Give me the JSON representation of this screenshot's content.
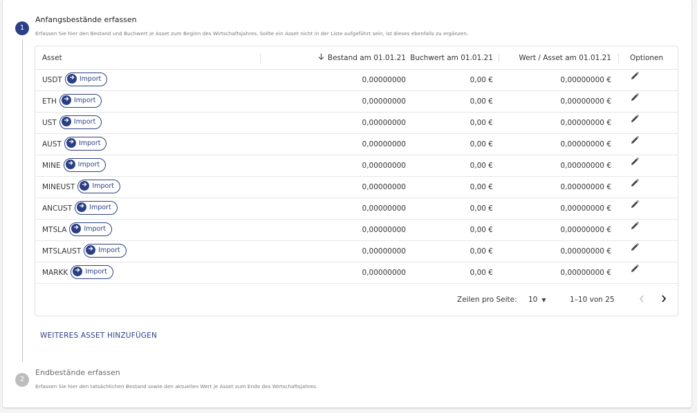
{
  "steps": [
    {
      "number": "1",
      "title": "Anfangsbestände erfassen",
      "description": "Erfassen Sie hier den Bestand und Buchwert je Asset zum Beginn des Wirtschaftsjahres. Sollte ein Asset nicht in der Liste aufgeführt sein, ist dieses ebenfalls zu ergänzen."
    },
    {
      "number": "2",
      "title": "Endbestände erfassen",
      "description": "Erfassen Sie hier den tatsächlichen Bestand sowie den aktuellen Wert je Asset zum Ende des Wirtschaftsjahres."
    }
  ],
  "table": {
    "columns": {
      "asset": "Asset",
      "bestand": "Bestand am 01.01.21",
      "buchwert": "Buchwert am 01.01.21",
      "wert": "Wert / Asset am 01.01.21",
      "optionen": "Optionen"
    },
    "import_label": "Import",
    "rows": [
      {
        "asset": "USDT",
        "bestand": "0,00000000",
        "buchwert": "0,00 €",
        "wert": "0,00000000 €"
      },
      {
        "asset": "ETH",
        "bestand": "0,00000000",
        "buchwert": "0,00 €",
        "wert": "0,00000000 €"
      },
      {
        "asset": "UST",
        "bestand": "0,00000000",
        "buchwert": "0,00 €",
        "wert": "0,00000000 €"
      },
      {
        "asset": "AUST",
        "bestand": "0,00000000",
        "buchwert": "0,00 €",
        "wert": "0,00000000 €"
      },
      {
        "asset": "MINE",
        "bestand": "0,00000000",
        "buchwert": "0,00 €",
        "wert": "0,00000000 €"
      },
      {
        "asset": "MINEUST",
        "bestand": "0,00000000",
        "buchwert": "0,00 €",
        "wert": "0,00000000 €"
      },
      {
        "asset": "ANCUST",
        "bestand": "0,00000000",
        "buchwert": "0,00 €",
        "wert": "0,00000000 €"
      },
      {
        "asset": "MTSLA",
        "bestand": "0,00000000",
        "buchwert": "0,00 €",
        "wert": "0,00000000 €"
      },
      {
        "asset": "MTSLAUST",
        "bestand": "0,00000000",
        "buchwert": "0,00 €",
        "wert": "0,00000000 €"
      },
      {
        "asset": "MARKK",
        "bestand": "0,00000000",
        "buchwert": "0,00 €",
        "wert": "0,00000000 €"
      }
    ],
    "pagination": {
      "rows_per_page_label": "Zeilen pro Seite:",
      "rows_per_page_value": "10",
      "range": "1–10 von 25"
    }
  },
  "add_asset_label": "WEITERES ASSET HINZUFÜGEN",
  "colors": {
    "primary": "#2b3f86",
    "inactive_step": "#bdbdbd"
  },
  "icons": {
    "sort": "arrow-down-icon",
    "import": "arrow-right-circle-icon",
    "edit": "pencil-icon",
    "prev": "chevron-left-icon",
    "next": "chevron-right-icon",
    "dropdown": "caret-down-icon"
  }
}
